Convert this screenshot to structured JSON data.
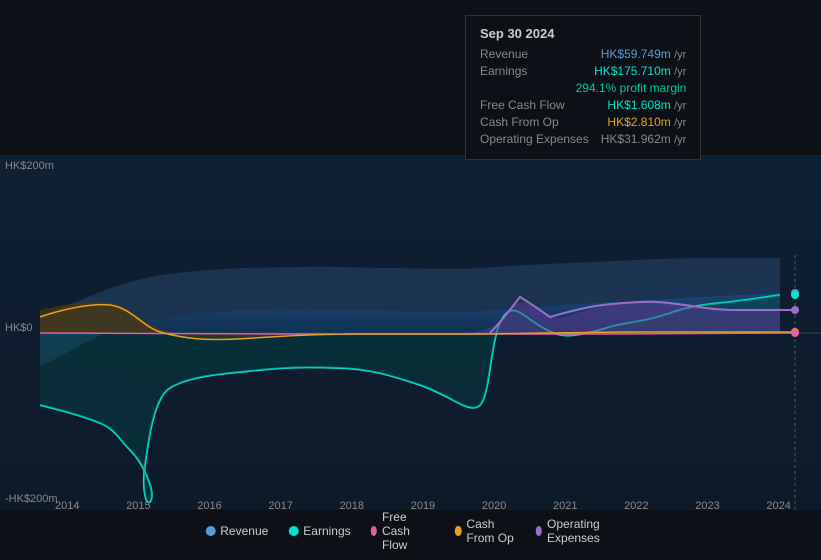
{
  "tooltip": {
    "date": "Sep 30 2024",
    "rows": [
      {
        "label": "Revenue",
        "value": "HK$59.749m",
        "unit": "/yr",
        "colorClass": "color-blue"
      },
      {
        "label": "Earnings",
        "value": "HK$175.710m",
        "unit": "/yr",
        "colorClass": "color-cyan"
      },
      {
        "label": "",
        "value": "294.1% profit margin",
        "unit": "",
        "colorClass": "color-green"
      },
      {
        "label": "Free Cash Flow",
        "value": "HK$1.608m",
        "unit": "/yr",
        "colorClass": "color-cyan"
      },
      {
        "label": "Cash From Op",
        "value": "HK$2.810m",
        "unit": "/yr",
        "colorClass": "color-orange"
      },
      {
        "label": "Operating Expenses",
        "value": "HK$31.962m",
        "unit": "/yr",
        "colorClass": "color-gray"
      }
    ]
  },
  "chart": {
    "y_top": "HK$200m",
    "y_zero": "HK$0",
    "y_bottom": "-HK$200m"
  },
  "x_axis": {
    "labels": [
      "2014",
      "2015",
      "2016",
      "2017",
      "2018",
      "2019",
      "2020",
      "2021",
      "2022",
      "2023",
      "2024"
    ]
  },
  "legend": {
    "items": [
      {
        "label": "Revenue",
        "color": "#5b9bd5",
        "id": "revenue"
      },
      {
        "label": "Earnings",
        "color": "#00e5c8",
        "id": "earnings"
      },
      {
        "label": "Free Cash Flow",
        "color": "#e060a0",
        "id": "fcf"
      },
      {
        "label": "Cash From Op",
        "color": "#e8a020",
        "id": "cashfromop"
      },
      {
        "label": "Operating Expenses",
        "color": "#9b6fc8",
        "id": "opex"
      }
    ]
  }
}
